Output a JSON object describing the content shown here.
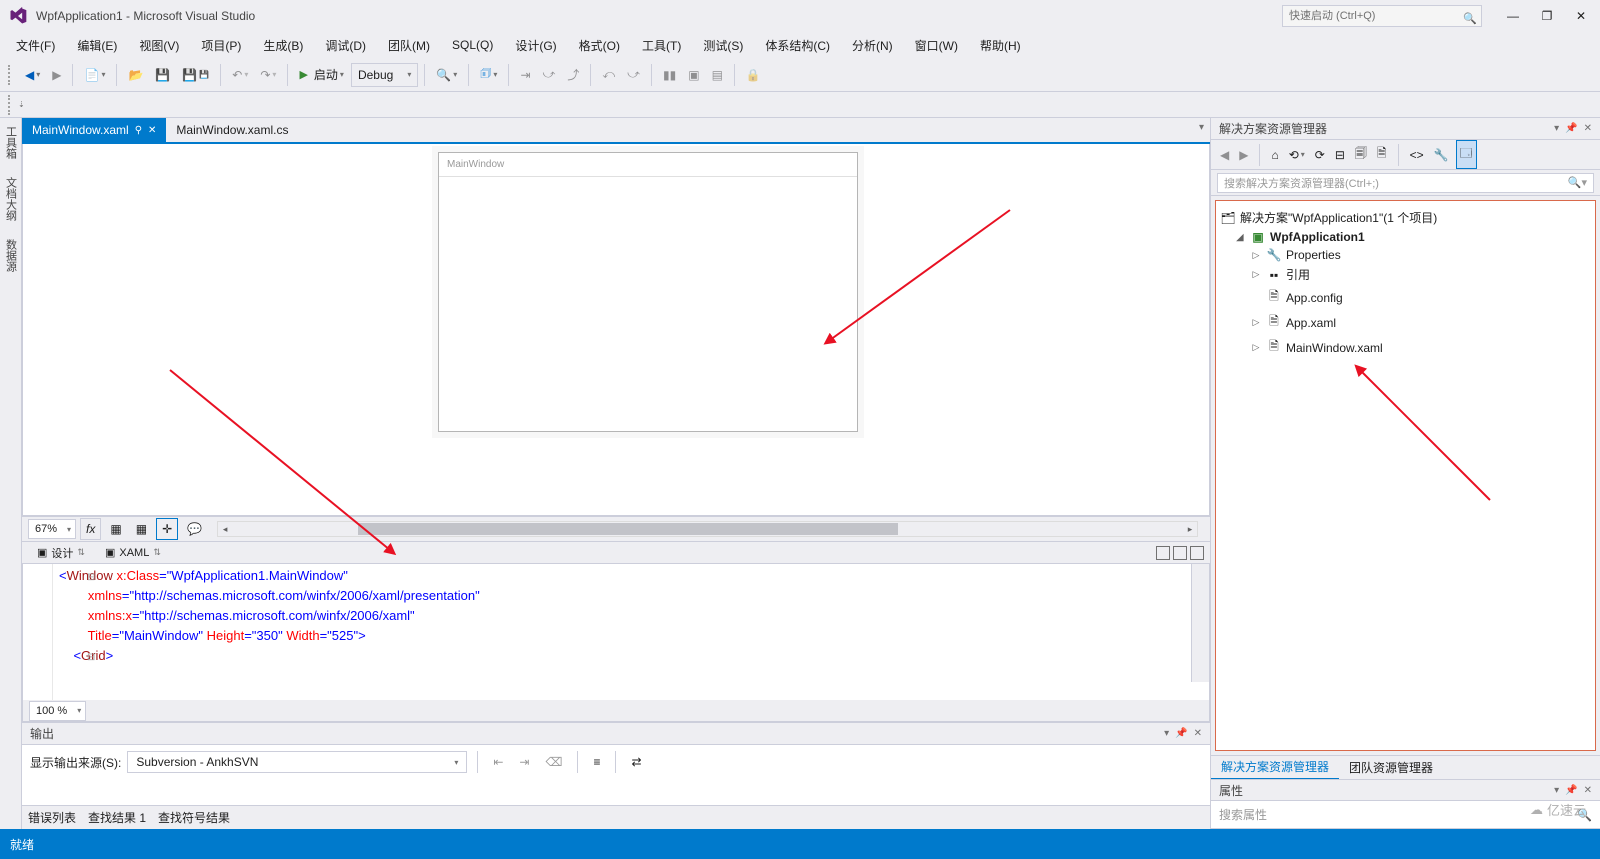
{
  "title": "WpfApplication1 - Microsoft Visual Studio",
  "quick_launch_placeholder": "快速启动 (Ctrl+Q)",
  "menu": [
    "文件(F)",
    "编辑(E)",
    "视图(V)",
    "项目(P)",
    "生成(B)",
    "调试(D)",
    "团队(M)",
    "SQL(Q)",
    "设计(G)",
    "格式(O)",
    "工具(T)",
    "测试(S)",
    "体系结构(C)",
    "分析(N)",
    "窗口(W)",
    "帮助(H)"
  ],
  "toolbar": {
    "start_label": "启动",
    "config": "Debug"
  },
  "side_tabs": [
    "工具箱",
    "文档大纲",
    "数据源"
  ],
  "doc_tabs": {
    "active": "MainWindow.xaml",
    "inactive": "MainWindow.xaml.cs"
  },
  "designer": {
    "window_title": "MainWindow",
    "zoom": "67%"
  },
  "split": {
    "design": "设计",
    "xaml": "XAML"
  },
  "code": {
    "l1a": "Window",
    "l1b": "x:Class",
    "l1c": "\"WpfApplication1.MainWindow\"",
    "l2a": "xmlns",
    "l2b": "\"http://schemas.microsoft.com/winfx/2006/xaml/presentation\"",
    "l3a": "xmlns:x",
    "l3b": "\"http://schemas.microsoft.com/winfx/2006/xaml\"",
    "l4a": "Title",
    "l4b": "\"MainWindow\"",
    "l4c": "Height",
    "l4d": "\"350\"",
    "l4e": "Width",
    "l4f": "\"525\"",
    "l5": "Grid",
    "zoom": "100 %"
  },
  "output": {
    "title": "输出",
    "src_label": "显示输出来源(S):",
    "src_value": "Subversion - AnkhSVN"
  },
  "bottom_tabs": [
    "错误列表",
    "查找结果 1",
    "查找符号结果"
  ],
  "solution_explorer": {
    "title": "解决方案资源管理器",
    "search_placeholder": "搜索解决方案资源管理器(Ctrl+;)",
    "solution": "解决方案\"WpfApplication1\"(1 个项目)",
    "project": "WpfApplication1",
    "items": [
      "Properties",
      "引用",
      "App.config",
      "App.xaml",
      "MainWindow.xaml"
    ],
    "tabs": [
      "解决方案资源管理器",
      "团队资源管理器"
    ]
  },
  "properties": {
    "title": "属性",
    "search_placeholder": "搜索属性"
  },
  "status": "就绪",
  "watermark": "亿速云"
}
